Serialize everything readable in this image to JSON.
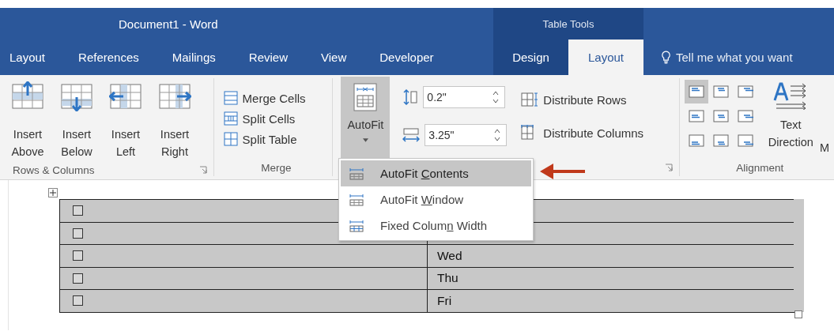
{
  "window": {
    "title": "Document1 - Word"
  },
  "tabs": [
    {
      "label": "Layout",
      "selected": false
    },
    {
      "label": "References",
      "selected": false
    },
    {
      "label": "Mailings",
      "selected": false
    },
    {
      "label": "Review",
      "selected": false
    },
    {
      "label": "View",
      "selected": false
    },
    {
      "label": "Developer",
      "selected": false
    }
  ],
  "contextual_tabs": {
    "title": "Table Tools",
    "tabs": [
      {
        "label": "Design",
        "selected": false
      },
      {
        "label": "Layout",
        "selected": true
      }
    ]
  },
  "tell_me": {
    "placeholder": "Tell me what you want"
  },
  "ribbon": {
    "groups": [
      {
        "kind": "rows_columns",
        "label": "Rows & Columns",
        "launcher": true,
        "buttons": [
          {
            "lines": [
              "Insert",
              "Above"
            ]
          },
          {
            "lines": [
              "Insert",
              "Below"
            ]
          },
          {
            "lines": [
              "Insert",
              "Left"
            ]
          },
          {
            "lines": [
              "Insert",
              "Right"
            ]
          }
        ]
      },
      {
        "kind": "merge",
        "label": "Merge",
        "launcher": false,
        "buttons": [
          "Merge Cells",
          "Split Cells",
          "Split Table"
        ]
      },
      {
        "kind": "cell_size",
        "launcher": true,
        "autofit": {
          "label": "AutoFit",
          "selected": true
        },
        "height": {
          "value": "0.2\""
        },
        "width": {
          "value": "3.25\""
        },
        "buttons": [
          "Distribute Rows",
          "Distribute Columns"
        ]
      },
      {
        "kind": "alignment",
        "label": "Alignment",
        "cells": [
          {
            "selected": true
          },
          {
            "selected": false
          },
          {
            "selected": false
          },
          {
            "selected": false
          },
          {
            "selected": false
          },
          {
            "selected": false
          },
          {
            "selected": false
          },
          {
            "selected": false
          },
          {
            "selected": false
          }
        ],
        "text_direction": [
          "Text",
          "Direction"
        ],
        "next_button": "M"
      }
    ]
  },
  "autofit_menu": {
    "items": [
      {
        "before": "AutoFit ",
        "key": "C",
        "after": "ontents",
        "selected": true
      },
      {
        "before": "AutoFit ",
        "key": "W",
        "after": "indow",
        "selected": false
      },
      {
        "before": "Fixed Colum",
        "key": "n",
        "after": " Width",
        "selected": false
      }
    ]
  },
  "table": {
    "rows": [
      {
        "checked": false
      },
      {
        "checked": false
      },
      {
        "checked": false,
        "text": "Wed"
      },
      {
        "checked": false,
        "text": "Thu"
      },
      {
        "checked": false,
        "text": "Fri"
      }
    ]
  }
}
